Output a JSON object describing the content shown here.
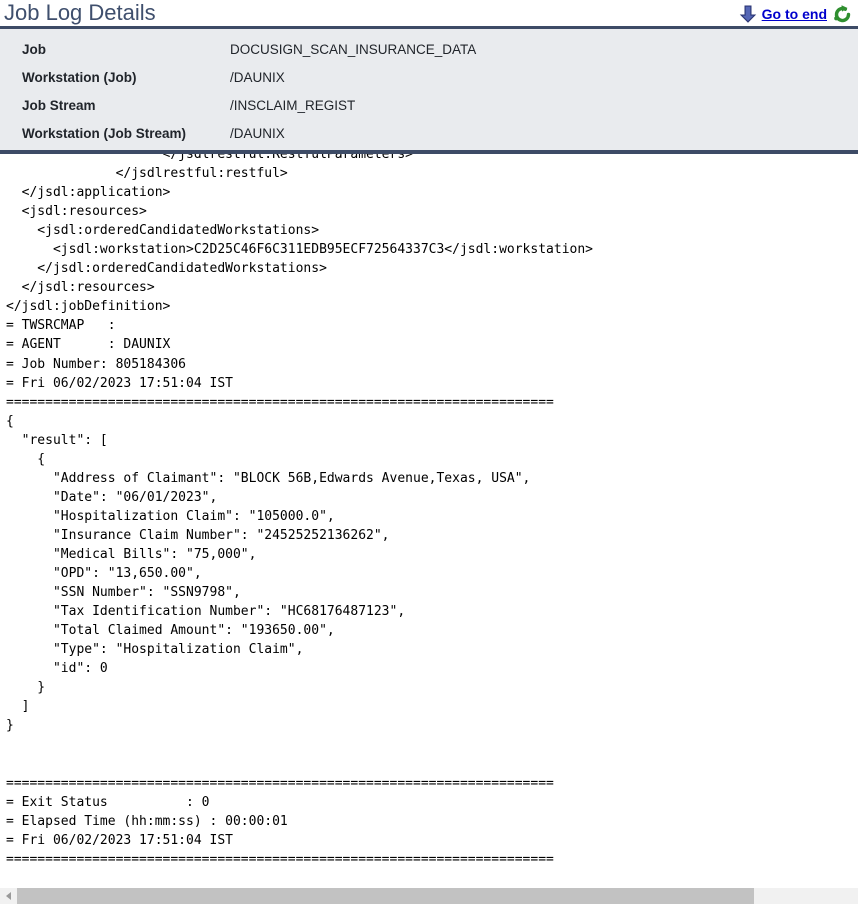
{
  "header": {
    "title": "Job Log Details",
    "go_to_end_label": "Go to end",
    "down_arrow_icon": "down-arrow-icon",
    "refresh_icon": "refresh-icon"
  },
  "job_info": {
    "rows": [
      {
        "label": "Job",
        "value": "DOCUSIGN_SCAN_INSURANCE_DATA"
      },
      {
        "label": "Workstation (Job)",
        "value": "/DAUNIX"
      },
      {
        "label": "Job Stream",
        "value": "/INSCLAIM_REGIST"
      },
      {
        "label": "Workstation (Job Stream)",
        "value": "/DAUNIX"
      }
    ]
  },
  "log": {
    "text": "                    </jsdlrestful:RestfulParameters>\n              </jsdlrestful:restful>\n  </jsdl:application>\n  <jsdl:resources>\n    <jsdl:orderedCandidatedWorkstations>\n      <jsdl:workstation>C2D25C46F6C311EDB95ECF72564337C3</jsdl:workstation>\n    </jsdl:orderedCandidatedWorkstations>\n  </jsdl:resources>\n</jsdl:jobDefinition>\n= TWSRCMAP   :\n= AGENT      : DAUNIX\n= Job Number: 805184306\n= Fri 06/02/2023 17:51:04 IST\n======================================================================\n{\n  \"result\": [\n    {\n      \"Address of Claimant\": \"BLOCK 56B,Edwards Avenue,Texas, USA\",\n      \"Date\": \"06/01/2023\",\n      \"Hospitalization Claim\": \"105000.0\",\n      \"Insurance Claim Number\": \"24525252136262\",\n      \"Medical Bills\": \"75,000\",\n      \"OPD\": \"13,650.00\",\n      \"SSN Number\": \"SSN9798\",\n      \"Tax Identification Number\": \"HC68176487123\",\n      \"Total Claimed Amount\": \"193650.00\",\n      \"Type\": \"Hospitalization Claim\",\n      \"id\": 0\n    }\n  ]\n}\n\n\n======================================================================\n= Exit Status          : 0\n= Elapsed Time (hh:mm:ss) : 00:00:01\n= Fri 06/02/2023 17:51:04 IST\n======================================================================"
  },
  "colors": {
    "title": "#3f4f6d",
    "panel_bg": "#e9ebee",
    "rule": "#3d4b66",
    "link": "#0000cc",
    "refresh_green": "#2f8f2f",
    "arrow_blue": "#2f3e8c",
    "scroll_thumb": "#c2c2c2"
  }
}
